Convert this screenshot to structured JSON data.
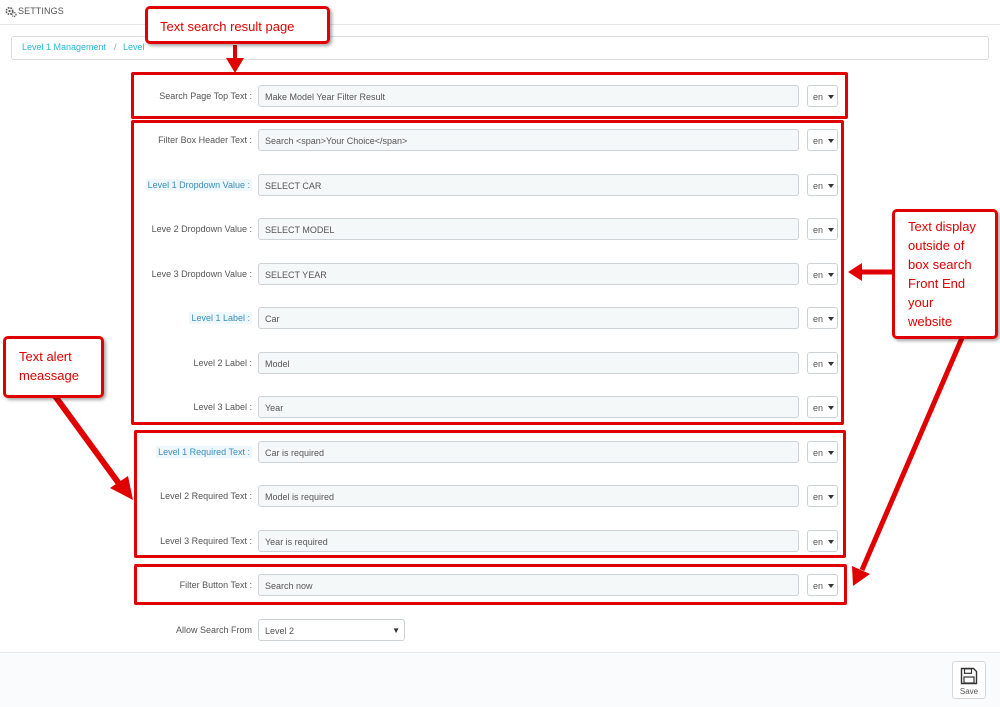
{
  "header": {
    "title": "SETTINGS",
    "icon": "gears-icon"
  },
  "breadcrumb": {
    "item1": "Level 1 Management",
    "separator": "/",
    "item2": "Level "
  },
  "fields": [
    {
      "label": "Search Page Top Text :",
      "value": "Make Model Year Filter Result",
      "lang": "en"
    },
    {
      "label": "Filter Box Header Text :",
      "value": "Search <span>Your Choice</span>",
      "lang": "en"
    },
    {
      "label": "Level 1 Dropdown Value :",
      "value": "SELECT CAR",
      "lang": "en"
    },
    {
      "label": "Leve 2 Dropdown Value :",
      "value": "SELECT MODEL",
      "lang": "en"
    },
    {
      "label": "Leve 3 Dropdown Value :",
      "value": "SELECT YEAR",
      "lang": "en"
    },
    {
      "label": "Level 1 Label :",
      "value": "Car",
      "lang": "en"
    },
    {
      "label": "Level 2 Label :",
      "value": "Model",
      "lang": "en"
    },
    {
      "label": "Level 3 Label :",
      "value": "Year",
      "lang": "en"
    },
    {
      "label": "Level 1 Required Text :",
      "value": "Car is required",
      "lang": "en"
    },
    {
      "label": "Level 2 Required Text :",
      "value": "Model is required",
      "lang": "en"
    },
    {
      "label": "Level 3 Required Text :",
      "value": "Year is required",
      "lang": "en"
    },
    {
      "label": "Filter Button Text :",
      "value": "Search now",
      "lang": "en"
    }
  ],
  "allow_search": {
    "label": "Allow Search From",
    "value": "Level 2"
  },
  "footer": {
    "save_label": "Save"
  },
  "annotations": {
    "search_result": "Text search result page",
    "display_line1": "Text display",
    "display_line2": "outside of",
    "display_line3": "box search",
    "display_line4": "Front End",
    "display_line5": "your",
    "display_line6": "website",
    "alert_line1": "Text alert",
    "alert_line2": "meassage"
  },
  "colors": {
    "annotation": "#e00000",
    "link": "#25b9d7",
    "highlight_label": "#3a8fbd"
  }
}
